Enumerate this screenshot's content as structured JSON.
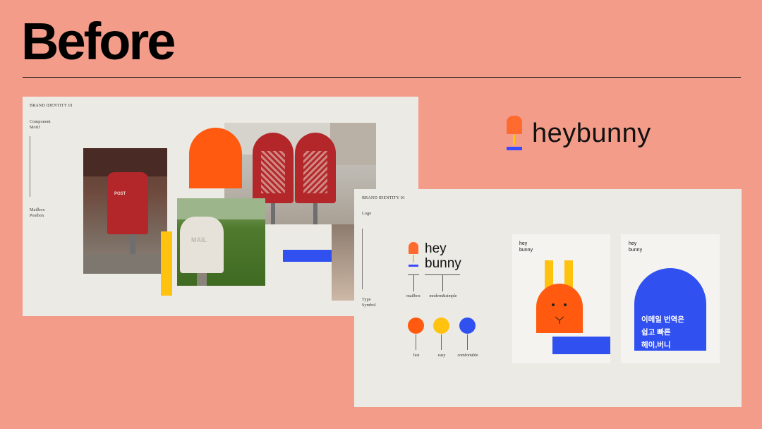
{
  "title": "Before",
  "board1": {
    "header": "BRAND IDENTITY 01",
    "label_top": [
      "Component",
      "Motif"
    ],
    "label_bottom": [
      "Mailbox",
      "Postbox"
    ],
    "mailbox_sign_left": "POST",
    "mailbox_sign_white": "MAIL"
  },
  "board2": {
    "header": "BRAND IDENTITY 01",
    "label_top": "Logo",
    "label_bottom": [
      "Type",
      "Symbol"
    ],
    "logo_hey": "hey",
    "logo_bunny": "bunny",
    "captions": [
      "mailbox",
      "modern&simple"
    ],
    "dots": [
      {
        "label": "fast",
        "color": "#FF5A0F"
      },
      {
        "label": "easy",
        "color": "#FFC20E"
      },
      {
        "label": "comfortable",
        "color": "#3050F0"
      }
    ],
    "card1": {
      "line1": "hey",
      "line2": "bunny"
    },
    "card2": {
      "line1": "hey",
      "line2": "bunny",
      "korean": [
        "이메일 번역은",
        "쉽고 빠른",
        "헤이,버니"
      ]
    }
  },
  "big_logo": "heybunny",
  "colors": {
    "background": "#F49C8A",
    "board": "#ECEAE4",
    "orange": "#FF5A0F",
    "yellow": "#FFC20E",
    "blue": "#3050F0"
  }
}
